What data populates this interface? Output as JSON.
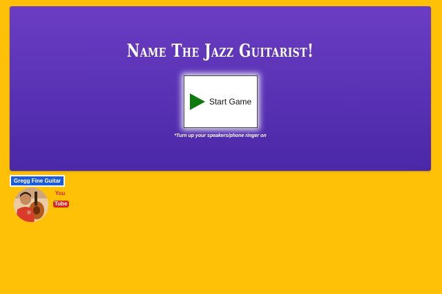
{
  "hero": {
    "title": "Name The Jazz Guitarist!",
    "start_button_label": "Start Game",
    "note": "*Turn up your speakers/phone ringer on"
  },
  "footer": {
    "brand": "Gregg Fine Guitar",
    "youtube_you": "You",
    "youtube_tube": "Tube"
  },
  "icons": {
    "play": "play-icon",
    "youtube": "youtube-icon",
    "avatar": "avatar-photo"
  },
  "colors": {
    "background": "#FFC107",
    "hero_top": "#6B3DC2",
    "hero_bottom": "#4A28A6",
    "play": "#0E7A0D",
    "brand_badge": "#1E5BD8",
    "youtube_red": "#D9251C"
  }
}
